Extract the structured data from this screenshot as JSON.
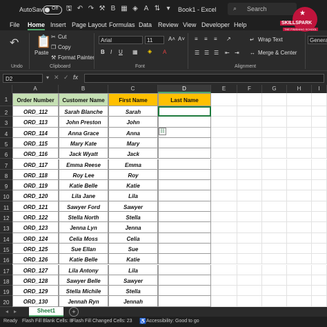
{
  "titlebar": {
    "autosave_label": "AutoSave",
    "autosave_state": "Off",
    "doc_title": "Book1 - Excel",
    "search_placeholder": "Search",
    "brand": "SKILLSPARK",
    "brand_tagline": "THE FINISHING SCHOOL"
  },
  "menu": [
    "File",
    "Home",
    "Insert",
    "Page Layout",
    "Formulas",
    "Data",
    "Review",
    "View",
    "Developer",
    "Help"
  ],
  "menu_active": "Home",
  "ribbon": {
    "paste": "Paste",
    "cut": "Cut",
    "copy": "Copy",
    "format_painter": "Format Painter",
    "font_name": "Arial",
    "font_size": "11",
    "bold": "B",
    "italic": "I",
    "underline": "U",
    "wrap_text": "Wrap Text",
    "merge_center": "Merge & Center",
    "number_format": "General",
    "group_undo": "Undo",
    "group_clipboard": "Clipboard",
    "group_font": "Font",
    "group_alignment": "Alignment"
  },
  "formula_bar": {
    "name_box": "D2",
    "fx": "fx",
    "value": ""
  },
  "columns": [
    "A",
    "B",
    "C",
    "D",
    "E",
    "F",
    "G",
    "H",
    "I"
  ],
  "selected_column": "D",
  "headers": [
    "Order Number",
    "Customer Name",
    "First Name",
    "Last Name"
  ],
  "rows": [
    {
      "num": "2",
      "order": "ORD_112",
      "customer": "Sarah Blanche",
      "first": "Sarah"
    },
    {
      "num": "3",
      "order": "ORD_113",
      "customer": "John Preston",
      "first": "John"
    },
    {
      "num": "4",
      "order": "ORD_114",
      "customer": "Anna Grace",
      "first": "Anna"
    },
    {
      "num": "5",
      "order": "ORD_115",
      "customer": "Mary Kate",
      "first": "Mary"
    },
    {
      "num": "6",
      "order": "ORD_116",
      "customer": "Jack Wyatt",
      "first": "Jack"
    },
    {
      "num": "7",
      "order": "ORD_117",
      "customer": "Emma Reese",
      "first": "Emma"
    },
    {
      "num": "8",
      "order": "ORD_118",
      "customer": "Roy Lee",
      "first": "Roy"
    },
    {
      "num": "9",
      "order": "ORD_119",
      "customer": "Katie Belle",
      "first": "Katie"
    },
    {
      "num": "10",
      "order": "ORD_120",
      "customer": "Lila Jane",
      "first": "Lila"
    },
    {
      "num": "11",
      "order": "ORD_121",
      "customer": "Sawyer Ford",
      "first": "Sawyer"
    },
    {
      "num": "12",
      "order": "ORD_122",
      "customer": "Stella North",
      "first": "Stella"
    },
    {
      "num": "13",
      "order": "ORD_123",
      "customer": "Jenna Lyn",
      "first": "Jenna"
    },
    {
      "num": "14",
      "order": "ORD_124",
      "customer": "Celia Moss",
      "first": "Celia"
    },
    {
      "num": "15",
      "order": "ORD_125",
      "customer": "Sue Ellan",
      "first": "Sue"
    },
    {
      "num": "16",
      "order": "ORD_126",
      "customer": "Katie Belle",
      "first": "Katie"
    },
    {
      "num": "17",
      "order": "ORD_127",
      "customer": "Lila Antony",
      "first": "Lila"
    },
    {
      "num": "18",
      "order": "ORD_128",
      "customer": "Sawyer Belle",
      "first": "Sawyer"
    },
    {
      "num": "19",
      "order": "ORD_129",
      "customer": "Stella Michile",
      "first": "Stella"
    },
    {
      "num": "20",
      "order": "ORD_130",
      "customer": "Jennah Ryn",
      "first": "Jennah"
    }
  ],
  "header_row_num": "1",
  "sheet_tab": "Sheet1",
  "status": {
    "ready": "Ready",
    "flash_blank": "Flash Fill Blank Cells: 8",
    "flash_changed": "Flash Fill Changed Cells: 23",
    "accessibility": "Accessibility: Good to go"
  },
  "colors": {
    "header_green": "#c6e0b4",
    "header_yellow": "#ffc000",
    "excel_green": "#4ea86b",
    "brand_red": "#c0143c"
  }
}
